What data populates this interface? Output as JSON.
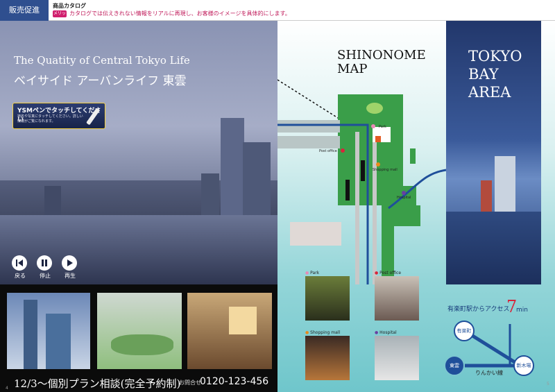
{
  "header": {
    "category": "販売促進",
    "title": "商品カタログ",
    "note_badge": "メリット",
    "note": "カタログでは伝えきれない情報をリアルに再現し、お客様のイメージを具体的にします。"
  },
  "left_page": {
    "headline_en": "The Quatity of Central Tokyo Life",
    "headline_jp": "ベイサイド アーバンライフ 東雲",
    "ysm": {
      "title": "YSMペンでタッチしてください",
      "desc": "地名や写真にタッチしてください。詳しい情報がご覧になれます。"
    },
    "controls": [
      {
        "label": "戻る",
        "icon": "rewind-icon"
      },
      {
        "label": "停止",
        "icon": "pause-icon"
      },
      {
        "label": "再生",
        "icon": "play-icon"
      }
    ],
    "cta": "12/3～個別プラン相談(完全予約制)",
    "inquiry_label": "お問合せ",
    "inquiry_number": "0120-123-456",
    "page_number": "4"
  },
  "right_page": {
    "map_title_line1": "SHINONOME",
    "map_title_line2": "MAP",
    "bay_line1": "TOKYO",
    "bay_line2": "BAY",
    "bay_line3": "AREA",
    "map_labels": {
      "park": "Park",
      "post": "Post office",
      "mall": "Shopping mall",
      "hospital": "Hospital"
    },
    "photos": [
      {
        "label": "Park",
        "color": "#e98ab6"
      },
      {
        "label": "Post office",
        "color": "#d8253b"
      },
      {
        "label": "Shopping mall",
        "color": "#e88a1c"
      },
      {
        "label": "Hospital",
        "color": "#6a3fa0"
      }
    ],
    "access_text": "有楽町駅からアクセス",
    "access_minutes": "7",
    "access_unit": "min",
    "stations": {
      "a": "有楽町",
      "b": "東雲",
      "c": "新木場"
    },
    "line_name": "りんかい線",
    "page_number": "5"
  },
  "colors": {
    "accent": "#2f4f8f",
    "pink": "#d0206e",
    "green": "#3a9e49"
  }
}
